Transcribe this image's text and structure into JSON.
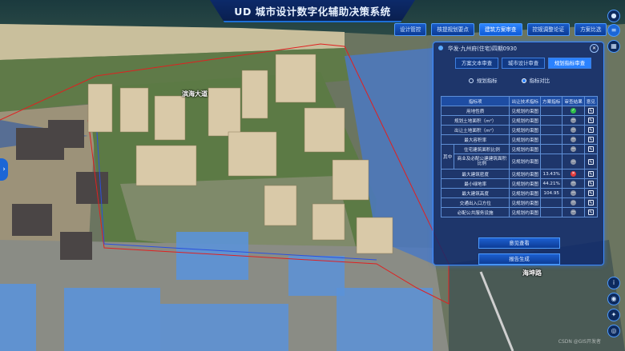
{
  "header": {
    "title": "UD 城市设计数字化辅助决策系统"
  },
  "topnav": {
    "items": [
      {
        "label": "设计管控"
      },
      {
        "label": "核提规划要点"
      },
      {
        "label": "建筑方案审查"
      },
      {
        "label": "控规调整论证"
      },
      {
        "label": "方案比选"
      }
    ]
  },
  "panel": {
    "title": "华发·九州府(住宅)四期0930",
    "tabs": [
      {
        "label": "方案文本审查"
      },
      {
        "label": "城市设计审查"
      },
      {
        "label": "规划指标审查"
      }
    ],
    "radios": [
      {
        "label": "规划指标"
      },
      {
        "label": "指标对比"
      }
    ],
    "columns": {
      "c1": "指标项",
      "c2": "出让技术指标",
      "c3": "方案指标",
      "c4": "审查结果",
      "c5": "意见"
    },
    "group_label": "其中",
    "rows": [
      {
        "name": "用地性质",
        "tech": "见规划约束图",
        "scheme": "",
        "status": "ok",
        "status_text": "✓"
      },
      {
        "name": "规划土地面积（m²）",
        "tech": "见规划约束图",
        "scheme": "",
        "status": "na",
        "status_text": "—"
      },
      {
        "name": "出让土地面积（m²）",
        "tech": "见规划约束图",
        "scheme": "",
        "status": "na",
        "status_text": "—"
      },
      {
        "name": "最大容积率",
        "tech": "见规划约束图",
        "scheme": "",
        "status": "na",
        "status_text": "—"
      },
      {
        "name": "住宅建筑面积比例",
        "tech": "见规划约束图",
        "scheme": "",
        "status": "na",
        "status_text": "—"
      },
      {
        "name": "商业及必配公建建筑面积比例",
        "tech": "见规划约束图",
        "scheme": "",
        "status": "na",
        "status_text": "—"
      },
      {
        "name": "最大建筑密度",
        "tech": "见规划约束图",
        "scheme": "13.43%",
        "status": "bad",
        "status_text": "✕"
      },
      {
        "name": "最小绿地率",
        "tech": "见规划约束图",
        "scheme": "44.21%",
        "status": "na",
        "status_text": "—"
      },
      {
        "name": "最大建筑高度",
        "tech": "见规划约束图",
        "scheme": "104.95",
        "status": "na",
        "status_text": "—"
      },
      {
        "name": "交通出入口方位",
        "tech": "见规划约束图",
        "scheme": "",
        "status": "na",
        "status_text": "—"
      },
      {
        "name": "必配公共服务设施",
        "tech": "见规划约束图",
        "scheme": "",
        "status": "na",
        "status_text": "—"
      }
    ],
    "btn_opinion": "意见查看",
    "btn_report": "报告生成"
  },
  "map": {
    "road_label_1": "滨海大道",
    "road_label_2": "海坤路",
    "watermark": "CSDN @GIS开发者"
  },
  "icons": {
    "left_toggle": "chevron-right-icon",
    "right_tools": [
      "user-icon",
      "list-icon",
      "layers-icon",
      "info-icon",
      "camera-icon",
      "compass-icon",
      "location-icon"
    ]
  },
  "colors": {
    "accent": "#2a82ff",
    "ok": "#2fbf4a",
    "bad": "#e23a3a"
  }
}
